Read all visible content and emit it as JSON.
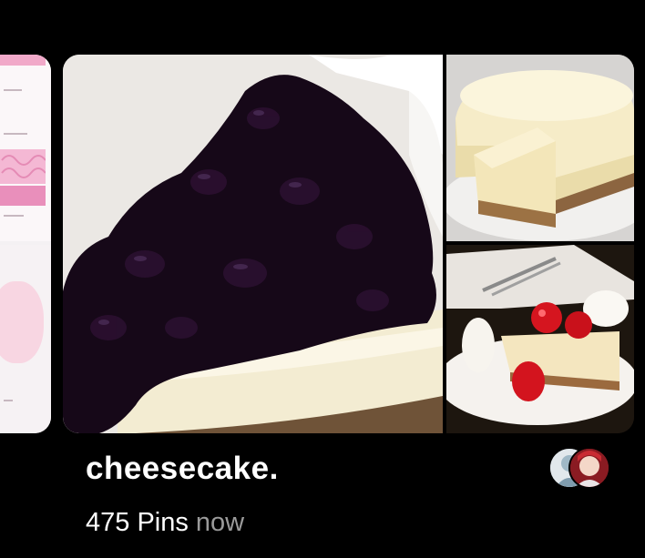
{
  "board": {
    "title": "cheesecake.",
    "pin_count": "475 Pins",
    "updated": "now"
  },
  "images": {
    "main": "blueberry-cheesecake-slice",
    "side_top": "plain-cheesecake",
    "side_bottom": "strawberry-cheesecake-plate",
    "previous_board": "pink-themed-board"
  },
  "colors": {
    "background": "#000000",
    "title": "#ffffff",
    "updated": "#9a9a9a"
  }
}
